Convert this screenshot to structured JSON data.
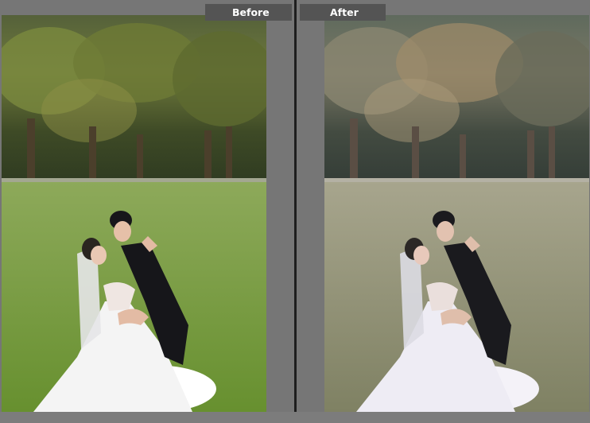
{
  "panels": {
    "before": {
      "label": "Before"
    },
    "after": {
      "label": "After"
    }
  },
  "colors": {
    "background": "#7a7a7a",
    "label_bg": "#545454",
    "label_text": "#ffffff",
    "divider": "#1e1e1e"
  },
  "photos": {
    "before": {
      "description_icon": "wedding-photo-original"
    },
    "after": {
      "description_icon": "wedding-photo-edited"
    }
  }
}
